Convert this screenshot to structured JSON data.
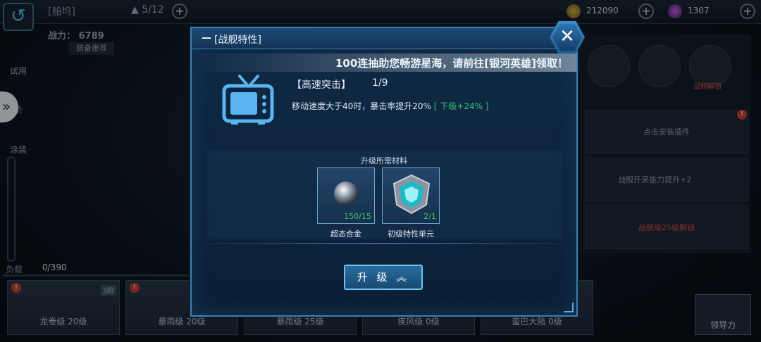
{
  "topbar": {
    "hangar_title": "[船坞]",
    "ship_count": "5/12",
    "coins": "212090",
    "gems": "1307"
  },
  "info": {
    "power_label": "战力：",
    "power_value": "6789",
    "recommend_label": "装备推荐"
  },
  "left_menu": [
    "试用",
    "价",
    "涂装"
  ],
  "load": {
    "label": "负载",
    "value": "0/390"
  },
  "ships": [
    {
      "name": "龙卷级 20级",
      "tier": "3阶"
    },
    {
      "name": "暴雨级 20级"
    },
    {
      "name": "暴雨级 25级"
    },
    {
      "name": "疾风级 0级"
    },
    {
      "name": "蛮巴大陆 0级"
    }
  ],
  "right_panel": {
    "lock_text": "战舰解锁",
    "install_plugin": "点击安装插件",
    "ability_text": "战舰开采能力提升+2",
    "unlock_text": "战舰级25级解锁",
    "lead_button": "领导力"
  },
  "modal": {
    "title": "[战舰特性]",
    "banner": "100连抽助您畅游星海，请前往[银河英雄]领取！",
    "trait_name": "【高速突击】",
    "trait_level": "1/9",
    "trait_desc": "移动速度大于40时，暴击率提升20%",
    "trait_next": "[ 下级+24% ]",
    "materials_title": "升级所需材料",
    "materials": [
      {
        "name": "超态合金",
        "count": "150/15"
      },
      {
        "name": "初级特性单元",
        "count": "2/1"
      }
    ],
    "upgrade_label": "升 级",
    "close_icon": "close-icon",
    "accent_color": "#3f7fb4",
    "progress_color": "#37c271"
  }
}
